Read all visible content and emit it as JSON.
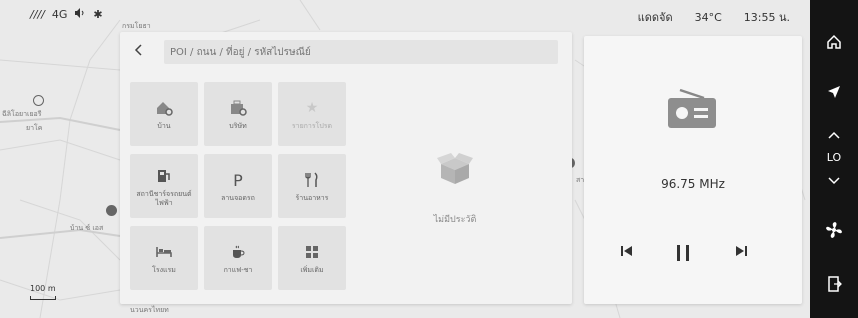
{
  "status_bar": {
    "signal": "////",
    "network": "4G",
    "brightness_mode": "แดดจัด",
    "temperature": "34°C",
    "time": "13:55 น."
  },
  "map": {
    "labels": [
      "กรมโยธา",
      "ฉีลิโอยาเยอรี",
      "ยาโค",
      "บ้าน ซ์ เอส",
      "นวนครไทยท",
      "สามเดย"
    ],
    "scale": "100 m"
  },
  "search": {
    "placeholder": "POI / ถนน / ที่อยู่ / รหัสไปรษณีย์"
  },
  "categories": [
    {
      "label": "บ้าน",
      "icon": "home-settings-icon"
    },
    {
      "label": "บริษัท",
      "icon": "company-icon"
    },
    {
      "label": "รายการโปรด",
      "icon": "star-icon"
    },
    {
      "label": "สถานีชาร์จรถยนต์ไฟฟ้า",
      "icon": "ev-charging-icon"
    },
    {
      "label": "ลานจอดรถ",
      "icon": "parking-icon"
    },
    {
      "label": "ร้านอาหาร",
      "icon": "restaurant-icon"
    },
    {
      "label": "โรงแรม",
      "icon": "hotel-icon"
    },
    {
      "label": "กาแฟ-ชา",
      "icon": "coffee-icon"
    },
    {
      "label": "เพิ่มเติม",
      "icon": "more-grid-icon"
    }
  ],
  "history": {
    "empty_label": "ไม่มีประวัติ"
  },
  "radio": {
    "frequency": "96.75 MHz"
  },
  "rail": {
    "fan_label": "LO"
  }
}
